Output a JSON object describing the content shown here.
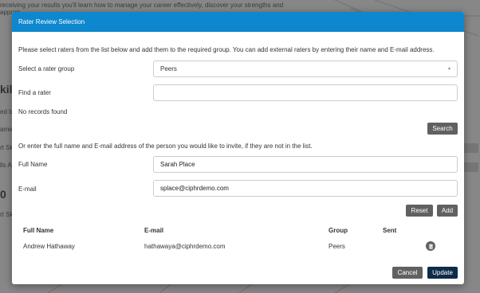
{
  "background": {
    "intro": "receiving your results you'll learn how to manage your career effectively, discover your strengths and",
    "intro2": "approp...",
    "side_heading": "kills",
    "side_fragments": [
      "ed by",
      "ame",
      "rt Sk",
      "lls A",
      "0",
      "rt Sk"
    ]
  },
  "modal": {
    "title": "Rater Review Selection",
    "instructions": "Please select raters from the list below and add them to the required group. You can add external raters by entering their name and E-mail address.",
    "rater_group": {
      "label": "Select a rater group",
      "value": "Peers"
    },
    "find_rater": {
      "label": "Find a rater",
      "value": "",
      "placeholder": ""
    },
    "no_records": "No records found",
    "search_label": "Search",
    "external_instructions": "Or enter the full name and E-mail address of the person you would like to invite, if they are not in the list.",
    "full_name": {
      "label": "Full Name",
      "value": "Sarah Place"
    },
    "email": {
      "label": "E-mail",
      "value": "splace@ciphrdemo.com"
    },
    "reset_label": "Reset",
    "add_label": "Add",
    "table": {
      "headers": {
        "full_name": "Full Name",
        "email": "E-mail",
        "group": "Group",
        "sent": "Sent"
      },
      "rows": [
        {
          "full_name": "Andrew Hathaway",
          "email": "hathawaya@ciphrdemo.com",
          "group": "Peers",
          "sent": "",
          "action_icon": "trash-icon"
        }
      ]
    },
    "cancel_label": "Cancel",
    "update_label": "Update"
  },
  "colors": {
    "header_blue": "#0d87cd",
    "button_gray": "#616161",
    "button_primary": "#0d2c4a"
  }
}
